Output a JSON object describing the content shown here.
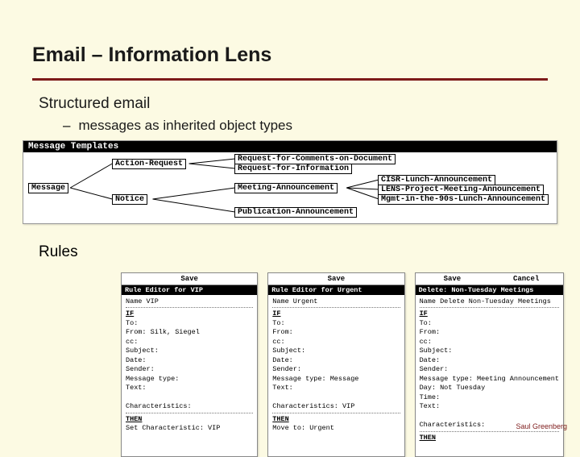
{
  "title": "Email – Information Lens",
  "section1": {
    "heading": "Structured email",
    "bullet": "messages as inherited object types"
  },
  "templates": {
    "header": "Message Templates",
    "nodes": {
      "root": "Message",
      "c1": "Action-Request",
      "c2": "Notice",
      "c1a": "Request-for-Comments-on-Document",
      "c1b": "Request-for-Information",
      "c2a": "Meeting-Announcement",
      "c2b": "Publication-Announcement",
      "c2a1": "CISR-Lunch-Announcement",
      "c2a2": "LENS-Project-Meeting-Announcement",
      "c2a3": "Mgmt-in-the-90s-Lunch-Announcement"
    }
  },
  "rules_heading": "Rules",
  "rules": [
    {
      "save": "Save",
      "cancel": "",
      "title": "Rule Editor for VIP",
      "name": "Name VIP",
      "fields": [
        "To:",
        "From: Silk, Siegel",
        "cc:",
        "Subject:",
        "Date:",
        "Sender:",
        "Message type:",
        "Text:",
        "",
        "Characteristics:"
      ],
      "then": "Set Characteristic: VIP"
    },
    {
      "save": "Save",
      "cancel": "",
      "title": "Rule Editor for Urgent",
      "name": "Name Urgent",
      "fields": [
        "To:",
        "From:",
        "cc:",
        "Subject:",
        "Date:",
        "Sender:",
        "Message type: Message",
        "Text:",
        "",
        "Characteristics: VIP"
      ],
      "then": "Move to: Urgent"
    },
    {
      "save": "Save",
      "cancel": "Cancel",
      "title": "Delete: Non-Tuesday Meetings",
      "name": "Name Delete Non-Tuesday Meetings",
      "fields": [
        "To:",
        "From:",
        "cc:",
        "Subject:",
        "Date:",
        "Sender:",
        "Message type: Meeting Announcement",
        "Day: Not Tuesday",
        "Time:",
        "Text:",
        "",
        "Characteristics:"
      ],
      "then": ""
    }
  ],
  "footer": "Saul Greenberg"
}
